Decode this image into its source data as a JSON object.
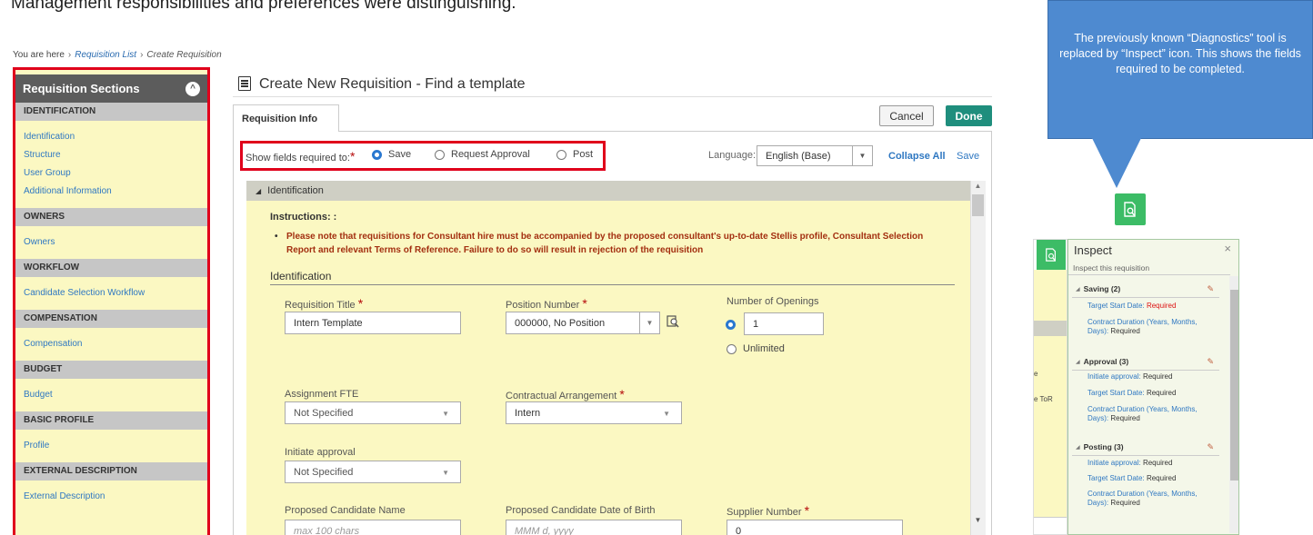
{
  "top_text": "Management responsibilities and preferences were distinguishing.",
  "breadcrumb": {
    "prefix": "You are here",
    "link": "Requisition List",
    "current": "Create Requisition"
  },
  "sidebar": {
    "title": "Requisition Sections",
    "groups": [
      {
        "header": "IDENTIFICATION",
        "items": [
          "Identification",
          "Structure",
          "User Group",
          "Additional Information"
        ]
      },
      {
        "header": "OWNERS",
        "items": [
          "Owners"
        ]
      },
      {
        "header": "WORKFLOW",
        "items": [
          "Candidate Selection Workflow"
        ]
      },
      {
        "header": "COMPENSATION",
        "items": [
          "Compensation"
        ]
      },
      {
        "header": "BUDGET",
        "items": [
          "Budget"
        ]
      },
      {
        "header": "BASIC PROFILE",
        "items": [
          "Profile"
        ]
      },
      {
        "header": "EXTERNAL DESCRIPTION",
        "items": [
          "External Description"
        ]
      }
    ]
  },
  "main": {
    "title": "Create New Requisition - Find a template",
    "tab": "Requisition Info",
    "cancel": "Cancel",
    "done": "Done",
    "show_fields_label": "Show fields required to:",
    "required_star": "*",
    "radio_options": [
      "Save",
      "Request Approval",
      "Post"
    ],
    "selected_option": "Save",
    "language_label": "Language:",
    "language_value": "English (Base)",
    "collapse_all": "Collapse All",
    "save_link": "Save",
    "section_title": "Identification",
    "instructions_label": "Instructions: :",
    "instruction_text": "Please note that requisitions for Consultant hire must be accompanied by the proposed consultant's up-to-date Stellis profile, Consultant Selection Report and relevant Terms of Reference.  Failure to do so will result in rejection of the requisition",
    "identification_heading": "Identification",
    "fields": {
      "requisition_title_label": "Requisition Title",
      "requisition_title_value": "Intern Template",
      "position_number_label": "Position Number",
      "position_number_value": "000000, No Position",
      "openings_label": "Number of Openings",
      "openings_value": "1",
      "unlimited_label": "Unlimited",
      "fte_label": "Assignment FTE",
      "fte_value": "Not Specified",
      "arrangement_label": "Contractual Arrangement",
      "arrangement_value": "Intern",
      "initiate_label": "Initiate approval",
      "initiate_value": "Not Specified",
      "candidate_name_label": "Proposed Candidate Name",
      "candidate_name_placeholder": "max 100 chars",
      "dob_label": "Proposed Candidate Date of Birth",
      "dob_placeholder": "MMM d, yyyy",
      "supplier_label": "Supplier Number",
      "supplier_value": "0"
    }
  },
  "callout": {
    "text": "The previously known “Diagnostics” tool is replaced by “Inspect” icon. This shows the fields required to be completed."
  },
  "inspect": {
    "title": "Inspect",
    "close": "×",
    "subtitle": "Inspect this requisition",
    "bg_text_1": "e",
    "bg_text_2": "e ToR",
    "groups": [
      {
        "label": "Saving (2)",
        "items": [
          {
            "k": "Target Start Date:",
            "v": "Required",
            "red": true
          },
          {
            "k": "Contract Duration (Years, Months, Days):",
            "v": "Required",
            "red": false
          }
        ]
      },
      {
        "label": "Approval (3)",
        "items": [
          {
            "k": "Initiate approval:",
            "v": "Required",
            "red": false
          },
          {
            "k": "Target Start Date:",
            "v": "Required",
            "red": false
          },
          {
            "k": "Contract Duration (Years, Months, Days):",
            "v": "Required",
            "red": false
          }
        ]
      },
      {
        "label": "Posting (3)",
        "items": [
          {
            "k": "Initiate approval:",
            "v": "Required",
            "red": false
          },
          {
            "k": "Target Start Date:",
            "v": "Required",
            "red": false
          },
          {
            "k": "Contract Duration (Years, Months, Days):",
            "v": "Required",
            "red": false
          }
        ]
      }
    ]
  },
  "colors": {
    "highlight_red": "#e0001b",
    "done_green": "#1f8e7d",
    "inspect_green": "#3cbc66",
    "callout_blue": "#4e8ad0",
    "form_yellow": "#fbf8c2"
  }
}
